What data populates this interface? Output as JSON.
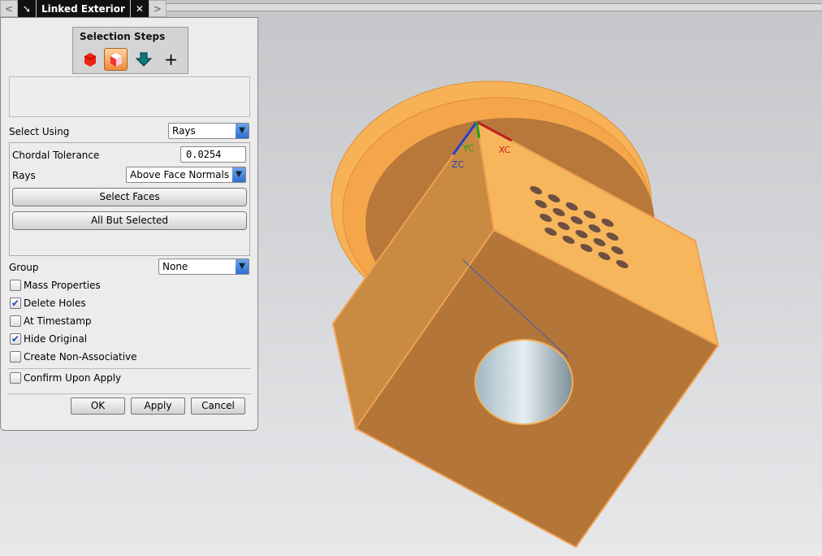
{
  "tab": {
    "title": "Linked Exterior"
  },
  "steps": {
    "title": "Selection Steps",
    "icons": [
      "solid-body-icon",
      "face-body-icon",
      "arrow-down-icon",
      "plus-icon"
    ]
  },
  "select_using": {
    "label": "Select Using",
    "value": "Rays"
  },
  "chordal": {
    "label": "Chordal Tolerance",
    "value": "0.0254"
  },
  "rays": {
    "label": "Rays",
    "value": "Above Face Normals"
  },
  "buttons": {
    "select_faces": "Select Faces",
    "all_but": "All But Selected",
    "ok": "OK",
    "apply": "Apply",
    "cancel": "Cancel"
  },
  "group": {
    "label": "Group",
    "value": "None"
  },
  "options": [
    {
      "label": "Mass Properties",
      "checked": false
    },
    {
      "label": "Delete Holes",
      "checked": true
    },
    {
      "label": "At Timestamp",
      "checked": false
    },
    {
      "label": "Hide Original",
      "checked": true
    },
    {
      "label": "Create Non-Associative",
      "checked": false
    }
  ],
  "confirm": {
    "label": "Confirm Upon Apply",
    "checked": false
  },
  "axes": {
    "x": "XC",
    "y": "YC",
    "z": "ZC"
  },
  "colors": {
    "part": "#f5a84c",
    "accent": "#2d6fd0"
  }
}
